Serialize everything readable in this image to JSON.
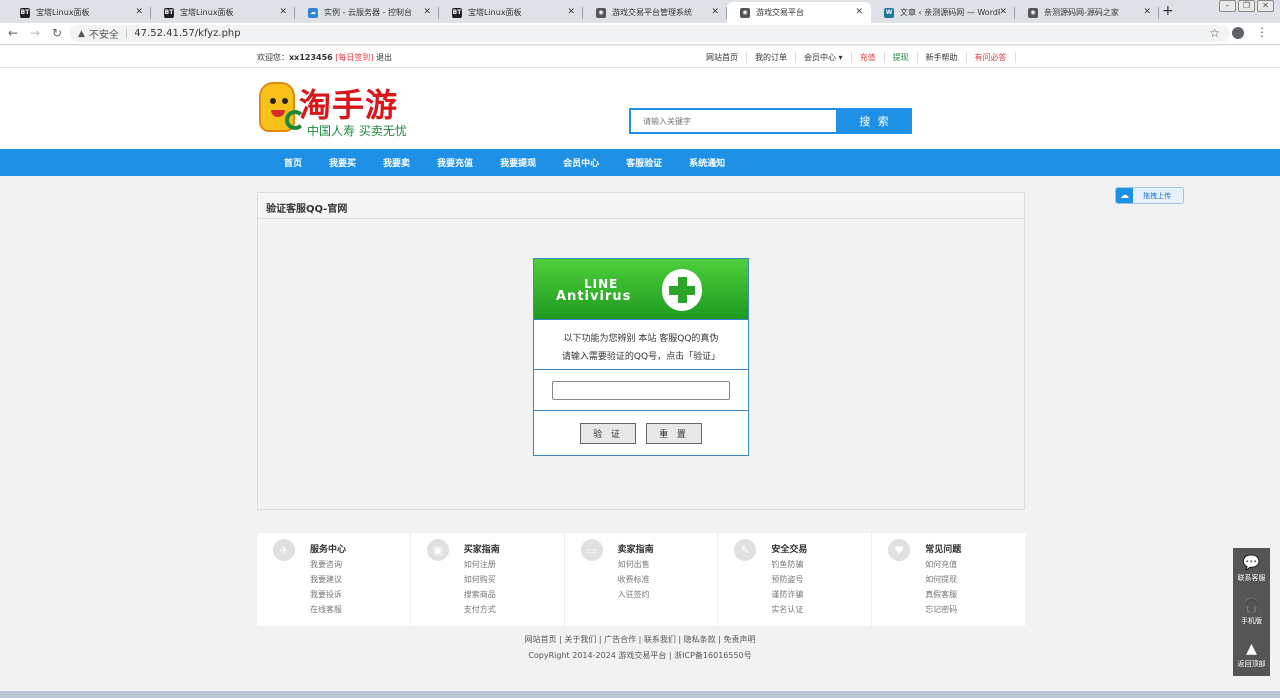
{
  "browser": {
    "tabs": [
      {
        "title": "宝塔Linux面板",
        "icon": "bt-icon",
        "fav": "BT"
      },
      {
        "title": "宝塔Linux面板",
        "icon": "bt-icon",
        "fav": "BT"
      },
      {
        "title": "实例 - 云服务器 - 控制台",
        "icon": "cloud-icon",
        "fav": "☁"
      },
      {
        "title": "宝塔Linux面板",
        "icon": "bt-icon",
        "fav": "BT"
      },
      {
        "title": "游戏交易平台管理系统",
        "icon": "globe-icon",
        "fav": "◉"
      },
      {
        "title": "游戏交易平台",
        "icon": "globe-icon",
        "fav": "◉"
      },
      {
        "title": "文章 ‹ 亲测源码网 — WordPress",
        "icon": "wordpress-icon",
        "fav": "W"
      },
      {
        "title": "亲测源码网-源码之家",
        "icon": "globe-icon",
        "fav": "◉"
      }
    ],
    "new_tab": "+",
    "security_label": "不安全",
    "url": "47.52.41.57/kfyz.php"
  },
  "topbar": {
    "welcome": "欢迎您：",
    "username": "xx123456",
    "signin": "[每日签到]",
    "logout": "退出",
    "links": [
      {
        "label": "网站首页",
        "color": "#333333"
      },
      {
        "label": "我的订单",
        "color": "#333333"
      },
      {
        "label": "会员中心 ▾",
        "color": "#333333"
      },
      {
        "label": "充值",
        "color": "#e4393c"
      },
      {
        "label": "提现",
        "color": "#1a8a3a"
      },
      {
        "label": "新手帮助",
        "color": "#333333"
      },
      {
        "label": "有问必答",
        "color": "#e4393c"
      }
    ]
  },
  "logo": {
    "main": "淘手游",
    "sub": "中国人寿 买卖无忧"
  },
  "search": {
    "placeholder": "请输入关键字",
    "button": "搜 索"
  },
  "mainnav": [
    "首页",
    "我要买",
    "我要卖",
    "我要充值",
    "我要提现",
    "会员中心",
    "客服验证",
    "系统通知"
  ],
  "panel": {
    "title": "验证客服QQ-官网",
    "banner_line1": "LINE",
    "banner_line2": "Antivirus",
    "text_line1": "以下功能为您辨别 本站 客服QQ的真伪",
    "text_line2": "请输入需要验证的QQ号，点击「验证」",
    "verify_btn": "验 证",
    "reset_btn": "重 置"
  },
  "upload": {
    "label": "拖拽上传"
  },
  "footer_cols": [
    {
      "title": "服务中心",
      "icon": "compass-icon",
      "items": [
        "我要咨询",
        "我要建议",
        "我要投诉",
        "在线客服"
      ]
    },
    {
      "title": "买家指南",
      "icon": "bus-icon",
      "items": [
        "如何注册",
        "如何购买",
        "搜索商品",
        "支付方式"
      ]
    },
    {
      "title": "卖家指南",
      "icon": "card-icon",
      "items": [
        "如何出售",
        "收费标准",
        "入驻签约"
      ]
    },
    {
      "title": "安全交易",
      "icon": "wrench-icon",
      "items": [
        "钓鱼防骗",
        "预防盗号",
        "谨防诈骗",
        "实名认证"
      ]
    },
    {
      "title": "常见问题",
      "icon": "heart-icon",
      "items": [
        "如何充值",
        "如何提现",
        "真假客服",
        "忘记密码"
      ]
    }
  ],
  "footer_links": "网站首页 | 关于我们 | 广告合作 | 联系我们 | 隐私条款 | 免责声明",
  "footer_copy": "CopyRight 2014-2024 游戏交易平台 | 浙ICP备16016550号",
  "sidebar": [
    {
      "label": "联系客服",
      "icon": "chat-icon",
      "glyph": "💬"
    },
    {
      "label": "手机版",
      "icon": "headset-icon",
      "glyph": "🎧"
    },
    {
      "label": "返回顶部",
      "icon": "rocket-icon",
      "glyph": "▲"
    }
  ]
}
